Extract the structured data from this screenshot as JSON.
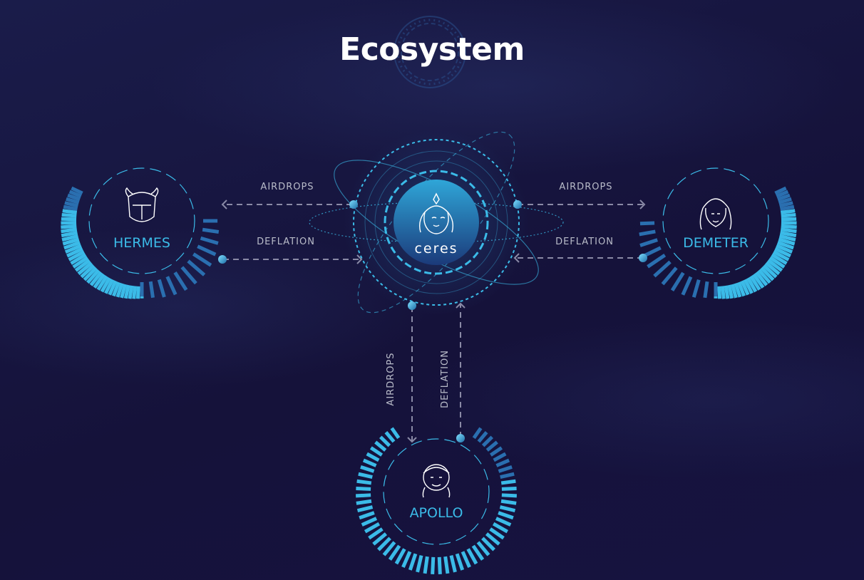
{
  "title": "Ecosystem",
  "center": {
    "label": "ceres",
    "icon": "goddess-face-icon"
  },
  "nodes": {
    "hermes": {
      "label": "HERMES",
      "icon": "winged-helmet-icon"
    },
    "demeter": {
      "label": "DEMETER",
      "icon": "goddess-portrait-icon"
    },
    "apollo": {
      "label": "APOLLO",
      "icon": "laurel-face-icon"
    }
  },
  "flows": {
    "hermes_airdrops": "AIRDROPS",
    "hermes_deflation": "DEFLATION",
    "demeter_airdrops": "AIRDROPS",
    "demeter_deflation": "DEFLATION",
    "apollo_airdrops": "AIRDROPS",
    "apollo_deflation": "DEFLATION"
  },
  "colors": {
    "background": "#15123a",
    "accent": "#3bbbe8",
    "accent_dark": "#1f6fa8",
    "arrow": "#8a8aa6",
    "label": "#b9bcc9"
  }
}
